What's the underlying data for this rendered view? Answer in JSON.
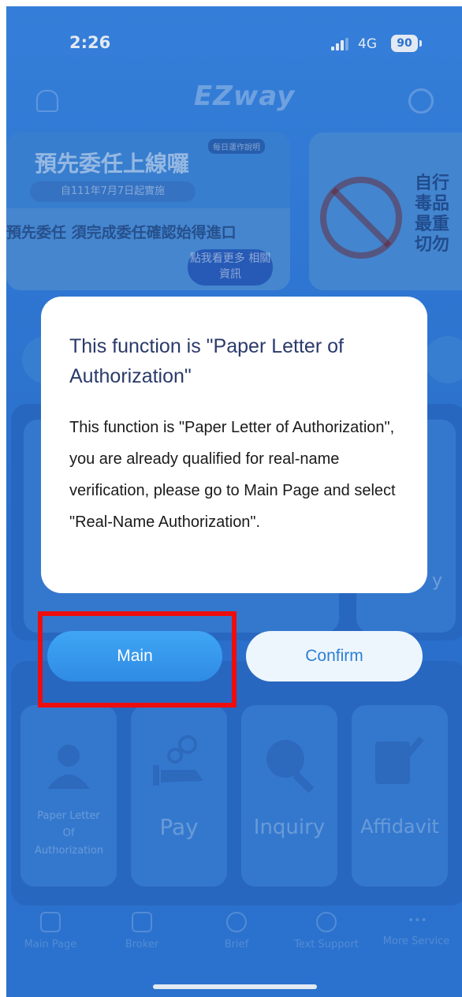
{
  "status_bar": {
    "time": "2:26",
    "network": "4G",
    "battery": "90"
  },
  "header": {
    "logo": "EZway"
  },
  "banner_left": {
    "title": "預先委任上線囉",
    "tag": "每日運作說明",
    "date": "自111年7月7日起實施",
    "subtitle": "預先委任 須完成委任確認始得進口",
    "cta": "點我看更多 相關資訊"
  },
  "banner_right": {
    "text": "自行\n毒品\n最重\n切勿"
  },
  "background_panel": {
    "partial_label": "y"
  },
  "tiles": [
    {
      "label": "Paper Letter Of Authorization",
      "icon": "person-icon"
    },
    {
      "label": "Pay",
      "icon": "coin-hand-icon"
    },
    {
      "label": "Inquiry",
      "icon": "magnifier-icon"
    },
    {
      "label": "Affidavit",
      "icon": "document-pen-icon"
    }
  ],
  "tab_bar": [
    {
      "label": "Main Page",
      "icon": "home-icon"
    },
    {
      "label": "Broker",
      "icon": "list-icon"
    },
    {
      "label": "Brief",
      "icon": "smile-icon"
    },
    {
      "label": "Text Support",
      "icon": "chat-icon"
    },
    {
      "label": "More Service",
      "icon": "more-icon"
    }
  ],
  "dialog": {
    "title": "This function is \"Paper Letter of Authorization\"",
    "body": "This function is \"Paper Letter of Authorization\", you are already qualified for real-name verification, please go to Main Page and select \"Real-Name Authorization\".",
    "main_button": "Main",
    "confirm_button": "Confirm"
  },
  "colors": {
    "highlight": "#ee0d0d",
    "primary": "#2f8be4"
  }
}
